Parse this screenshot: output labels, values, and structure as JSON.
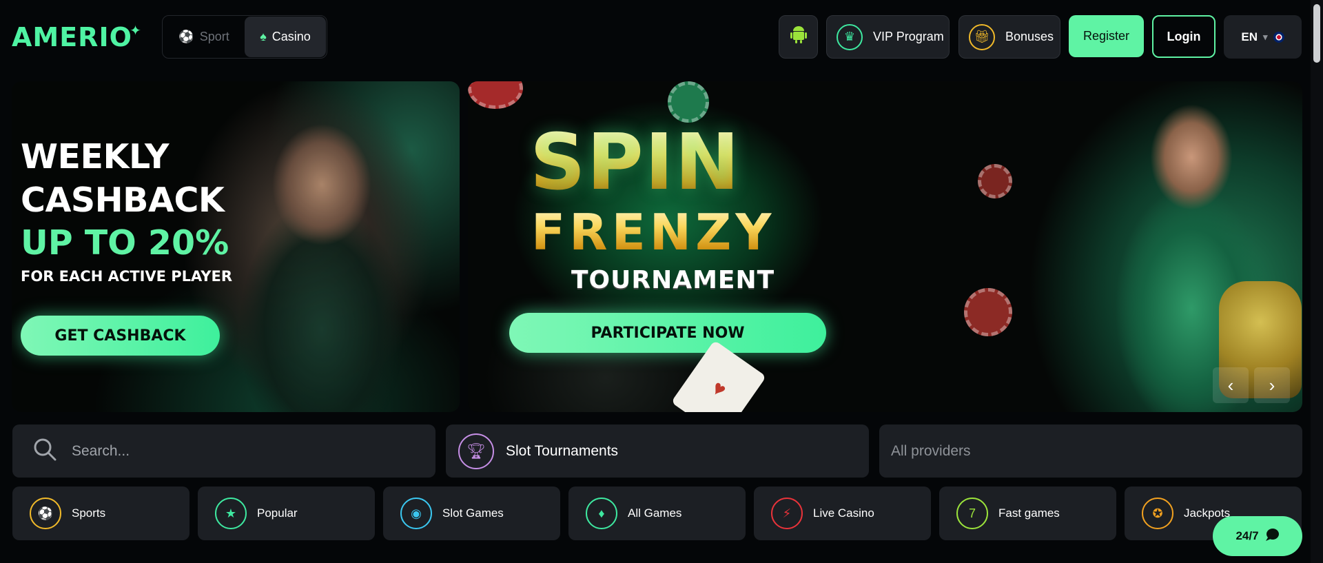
{
  "header": {
    "logo": "AMERIO",
    "mode_switch": {
      "sport_label": "Sport",
      "casino_label": "Casino"
    },
    "vip_label": "VIP Program",
    "bonuses_label": "Bonuses",
    "register_label": "Register",
    "login_label": "Login",
    "language": "EN"
  },
  "banners": {
    "cashback": {
      "title_line1": "WEEKLY",
      "title_line2": "CASHBACK",
      "accent": "UP TO 20%",
      "subtitle": "FOR EACH ACTIVE PLAYER",
      "button": "GET CASHBACK"
    },
    "tournament": {
      "line1": "SPIN",
      "line2": "FRENZY",
      "line3": "TOURNAMENT",
      "button": "PARTICIPATE NOW"
    }
  },
  "filters": {
    "search_placeholder": "Search...",
    "tournaments_label": "Slot Tournaments",
    "providers_label": "All providers"
  },
  "categories": [
    {
      "label": "Sports",
      "color": "#f0b92a"
    },
    {
      "label": "Popular",
      "color": "#3ee8a0"
    },
    {
      "label": "Slot Games",
      "color": "#3bc7f0"
    },
    {
      "label": "All Games",
      "color": "#3ee8a0"
    },
    {
      "label": "Live Casino",
      "color": "#e8333a"
    },
    {
      "label": "Fast games",
      "color": "#9be33b"
    },
    {
      "label": "Jackpots",
      "color": "#f0a020"
    }
  ],
  "support": {
    "label": "24/7"
  },
  "colors": {
    "accent": "#5ff3a4",
    "panel": "#1c1f24",
    "background": "#040608"
  }
}
